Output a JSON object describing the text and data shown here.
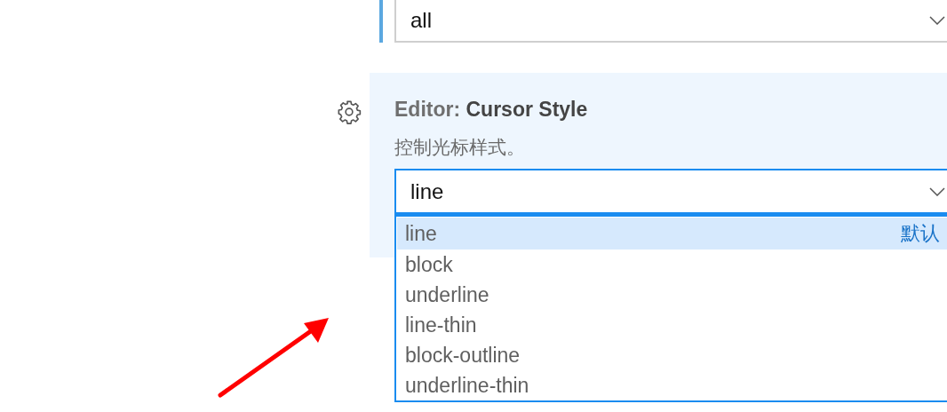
{
  "previous_setting": {
    "value": "all",
    "modified": true
  },
  "cursor_setting": {
    "category": "Editor:",
    "title": "Cursor Style",
    "description": "控制光标样式。",
    "value": "line",
    "expanded": true,
    "options": [
      {
        "label": "line",
        "selected": true,
        "badge": "默认"
      },
      {
        "label": "block",
        "selected": false
      },
      {
        "label": "underline",
        "selected": false
      },
      {
        "label": "line-thin",
        "selected": false
      },
      {
        "label": "block-outline",
        "selected": false
      },
      {
        "label": "underline-thin",
        "selected": false
      }
    ]
  }
}
